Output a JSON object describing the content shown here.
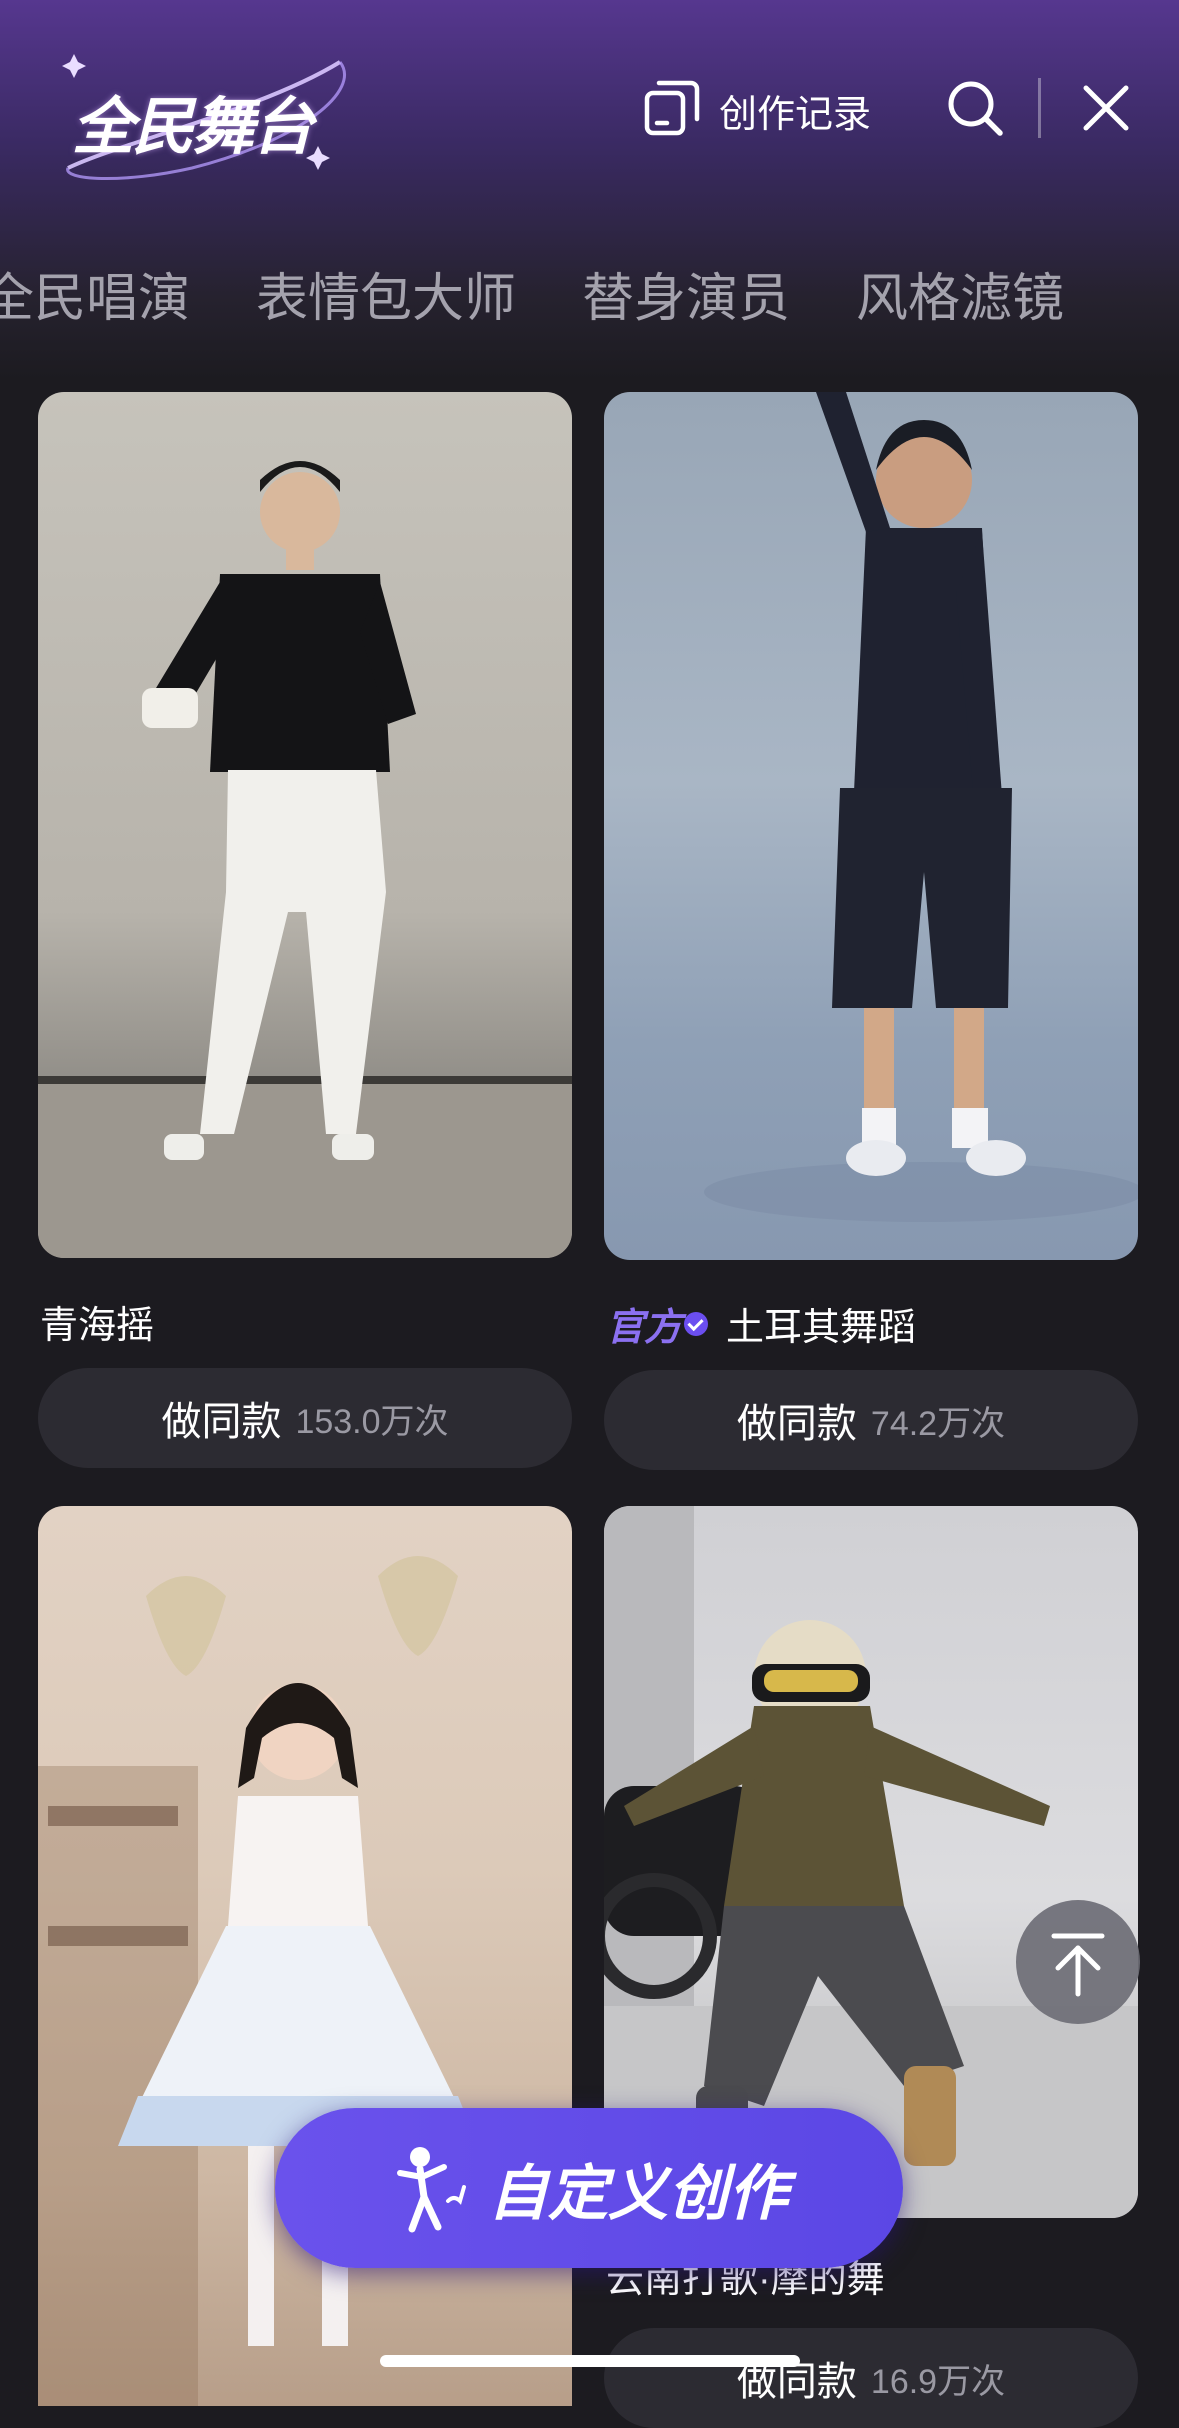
{
  "header": {
    "logo_text": "全民舞台",
    "records_label": "创作记录"
  },
  "tabs": [
    {
      "label": "全民唱演"
    },
    {
      "label": "表情包大师"
    },
    {
      "label": "替身演员"
    },
    {
      "label": "风格滤镜"
    }
  ],
  "cards": [
    {
      "title": "青海摇",
      "badge": "",
      "button_label": "做同款",
      "count": "153.0万次"
    },
    {
      "title": "土耳其舞蹈",
      "badge": "官方",
      "button_label": "做同款",
      "count": "74.2万次"
    },
    {
      "title": "",
      "badge": "",
      "button_label": "",
      "count": ""
    },
    {
      "title": "云南打歌·摩的舞",
      "badge": "",
      "button_label": "做同款",
      "count": "16.9万次"
    }
  ],
  "create_button": {
    "label": "自定义创作"
  },
  "colors": {
    "accent": "#5b47e5",
    "official": "#8b70f0",
    "background": "#1c1b20",
    "button_bg": "#2c2b32"
  },
  "icons": {
    "records": "copy-document-icon",
    "search": "search-icon",
    "close": "close-icon",
    "to_top": "arrow-up-to-top-icon",
    "create": "dancing-person-icon"
  }
}
